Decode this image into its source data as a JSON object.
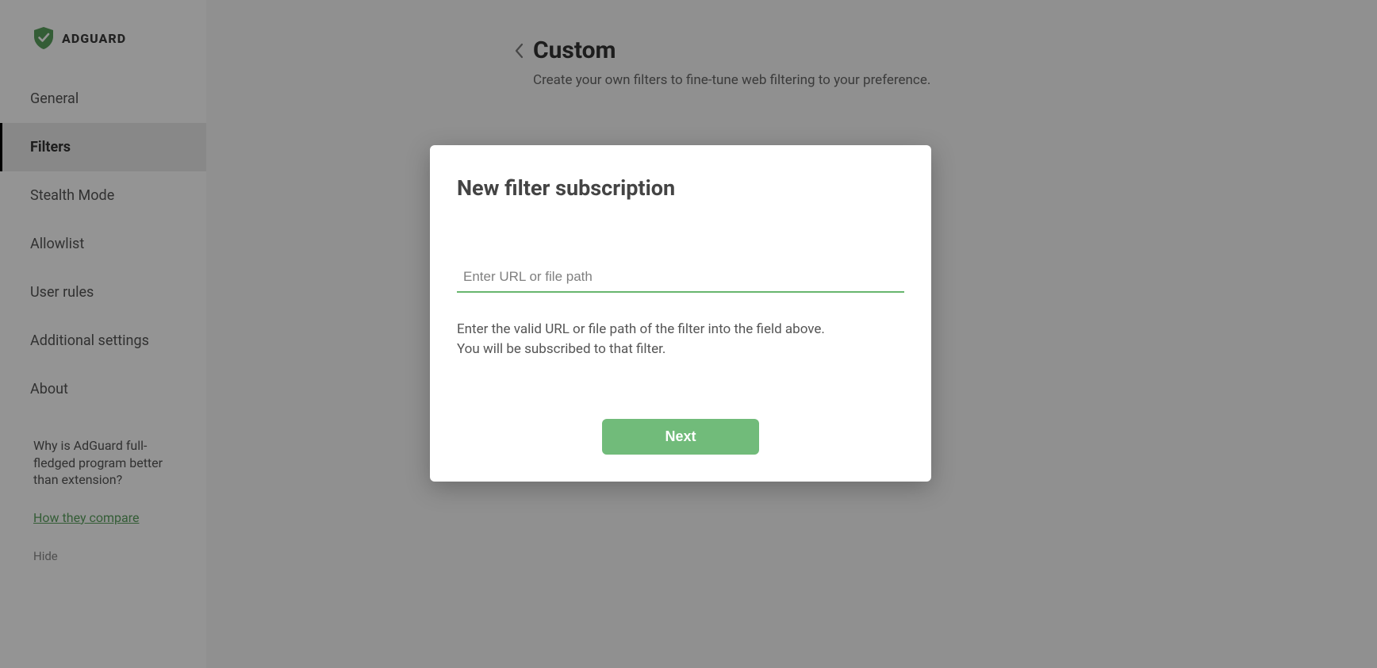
{
  "brand": {
    "name": "ADGUARD"
  },
  "sidebar": {
    "items": [
      {
        "label": "General"
      },
      {
        "label": "Filters"
      },
      {
        "label": "Stealth Mode"
      },
      {
        "label": "Allowlist"
      },
      {
        "label": "User rules"
      },
      {
        "label": "Additional settings"
      },
      {
        "label": "About"
      }
    ],
    "active_index": 1,
    "promo": {
      "text": "Why is AdGuard full-fledged program better than extension?",
      "compare_link": "How they compare",
      "hide": "Hide"
    }
  },
  "page": {
    "title": "Custom",
    "description": "Create your own filters to fine-tune web filtering to your preference.",
    "toggle_on": false
  },
  "modal": {
    "title": "New filter subscription",
    "url_placeholder": "Enter URL or file path",
    "url_value": "",
    "help_line1": "Enter the valid URL or file path of the filter into the field above.",
    "help_line2": "You will be subscribed to that filter.",
    "next_label": "Next"
  },
  "colors": {
    "accent": "#68b66e",
    "button": "#71bb7a"
  }
}
